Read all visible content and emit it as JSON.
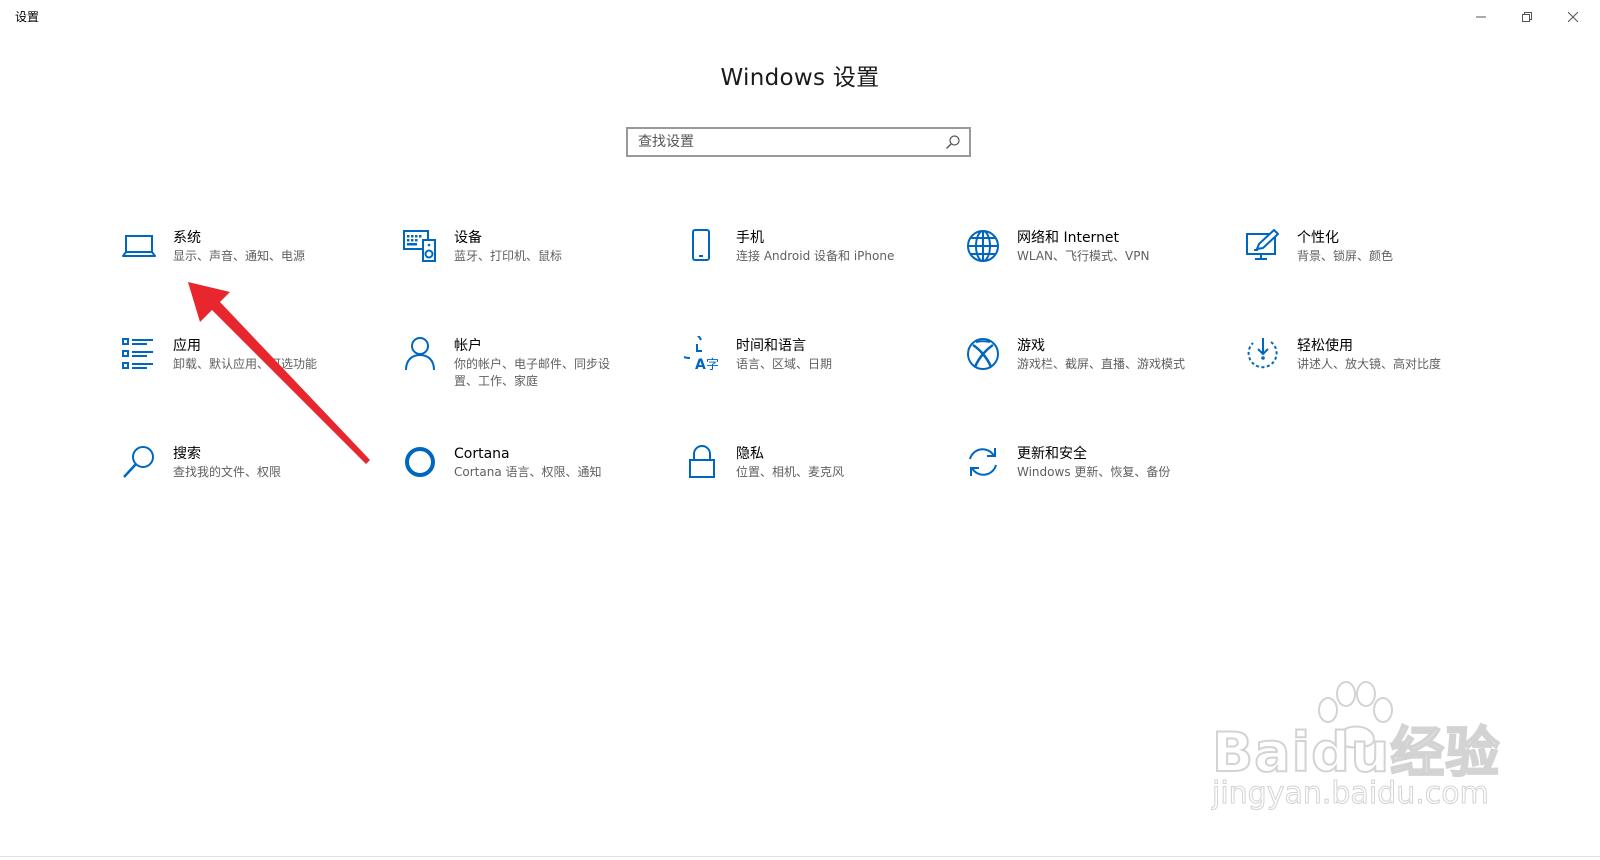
{
  "window": {
    "title": "设置",
    "minimize_label": "",
    "maximize_label": "",
    "close_label": ""
  },
  "header": {
    "title": "Windows 设置"
  },
  "search": {
    "placeholder": "查找设置"
  },
  "accent_color": "#0067c0",
  "arrow_color": "#e8262d",
  "tiles": [
    {
      "name": "系统",
      "desc": "显示、声音、通知、电源",
      "icon": "laptop-icon"
    },
    {
      "name": "设备",
      "desc": "蓝牙、打印机、鼠标",
      "icon": "devices-icon"
    },
    {
      "name": "手机",
      "desc": "连接 Android 设备和 iPhone",
      "icon": "phone-icon"
    },
    {
      "name": "网络和 Internet",
      "desc": "WLAN、飞行模式、VPN",
      "icon": "globe-icon"
    },
    {
      "name": "个性化",
      "desc": "背景、锁屏、颜色",
      "icon": "personalization-icon"
    },
    {
      "name": "应用",
      "desc": "卸载、默认应用、可选功能",
      "icon": "apps-icon"
    },
    {
      "name": "帐户",
      "desc": "你的帐户、电子邮件、同步设置、工作、家庭",
      "icon": "person-icon"
    },
    {
      "name": "时间和语言",
      "desc": "语言、区域、日期",
      "icon": "time-language-icon"
    },
    {
      "name": "游戏",
      "desc": "游戏栏、截屏、直播、游戏模式",
      "icon": "xbox-icon"
    },
    {
      "name": "轻松使用",
      "desc": "讲述人、放大镜、高对比度",
      "icon": "ease-of-access-icon"
    },
    {
      "name": "搜索",
      "desc": "查找我的文件、权限",
      "icon": "search-icon"
    },
    {
      "name": "Cortana",
      "desc": "Cortana 语言、权限、通知",
      "icon": "cortana-icon"
    },
    {
      "name": "隐私",
      "desc": "位置、相机、麦克风",
      "icon": "lock-icon"
    },
    {
      "name": "更新和安全",
      "desc": "Windows 更新、恢复、备份",
      "icon": "update-icon"
    }
  ],
  "watermark": {
    "line1": "Baidu经验",
    "line2": "jingyan.baidu.com"
  }
}
